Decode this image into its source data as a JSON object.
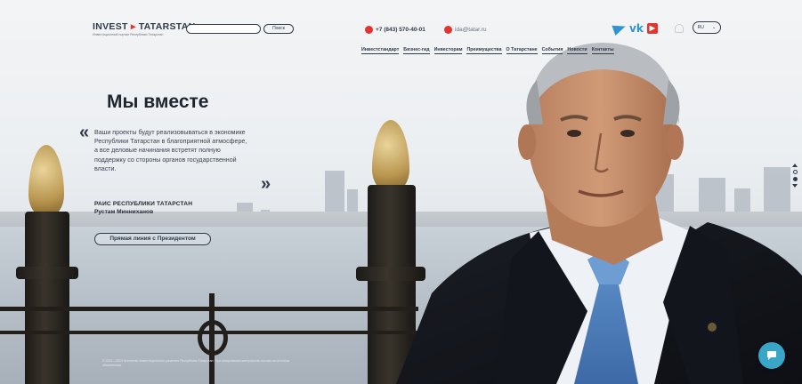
{
  "header": {
    "logo_title": "INVEST",
    "logo_title_2": "TATARSTAN",
    "logo_subtitle": "Инвестиционный портал Республики Татарстан",
    "search_placeholder": "",
    "search_button": "Поиск",
    "phone": "+7 (843) 570-40-01",
    "email": "ida@tatar.ru",
    "lang": "RU"
  },
  "nav": {
    "items": [
      "Инвестстандарт",
      "Бизнес-гид",
      "Инвесторам",
      "Преимущества",
      "О Татарстане",
      "События",
      "Новости",
      "Контакты"
    ]
  },
  "hero": {
    "title": "Мы вместе",
    "body": "Ваши проекты будут реализовываться в экономике Республики Татарстан в благоприятной атмосфере, а все деловые начинания встретят полную поддержку со стороны органов государственной власти.",
    "author_role": "РАИС РЕСПУБЛИКИ ТАТАРСТАН",
    "author_name": "Рустам Минниханов",
    "hotline_button": "Прямая линия с Президентом"
  },
  "footer": {
    "text": "© 2011—2023 Агентство инвестиционного развития Республики Татарстан. При копировании материалов ссылка на источник обязательна."
  },
  "colors": {
    "accent_red": "#e3342f",
    "accent_blue": "#2f93d3",
    "text_dark": "#2f3a4a",
    "chat_button": "#3aa6c7"
  }
}
